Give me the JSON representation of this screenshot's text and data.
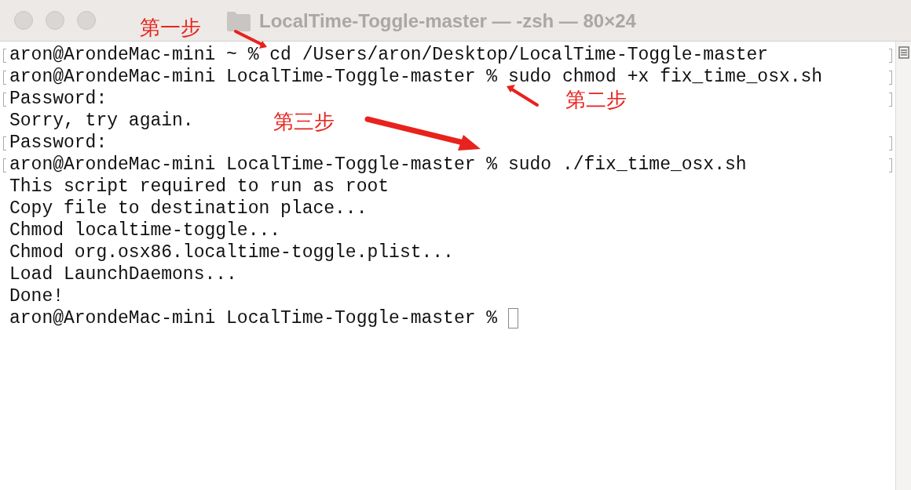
{
  "window": {
    "title": "LocalTime-Toggle-master — -zsh — 80×24"
  },
  "terminal": {
    "lines": [
      {
        "text": "aron@ArondeMac-mini ~ % cd /Users/aron/Desktop/LocalTime-Toggle-master",
        "marked": true,
        "cursor": false
      },
      {
        "text": "aron@ArondeMac-mini LocalTime-Toggle-master % sudo chmod +x fix_time_osx.sh",
        "marked": true,
        "cursor": false
      },
      {
        "text": "Password:",
        "marked": true,
        "cursor": false
      },
      {
        "text": "Sorry, try again.",
        "marked": false,
        "cursor": false
      },
      {
        "text": "Password:",
        "marked": true,
        "cursor": false
      },
      {
        "text": "aron@ArondeMac-mini LocalTime-Toggle-master % sudo ./fix_time_osx.sh",
        "marked": true,
        "cursor": false
      },
      {
        "text": "This script required to run as root",
        "marked": false,
        "cursor": false
      },
      {
        "text": "Copy file to destination place...",
        "marked": false,
        "cursor": false
      },
      {
        "text": "Chmod localtime-toggle...",
        "marked": false,
        "cursor": false
      },
      {
        "text": "Chmod org.osx86.localtime-toggle.plist...",
        "marked": false,
        "cursor": false
      },
      {
        "text": "Load LaunchDaemons...",
        "marked": false,
        "cursor": false
      },
      {
        "text": "Done!",
        "marked": false,
        "cursor": false
      },
      {
        "text": "aron@ArondeMac-mini LocalTime-Toggle-master % ",
        "marked": false,
        "cursor": true
      }
    ]
  },
  "annotations": [
    {
      "label": "第一步"
    },
    {
      "label": "第二步"
    },
    {
      "label": "第三步"
    }
  ]
}
